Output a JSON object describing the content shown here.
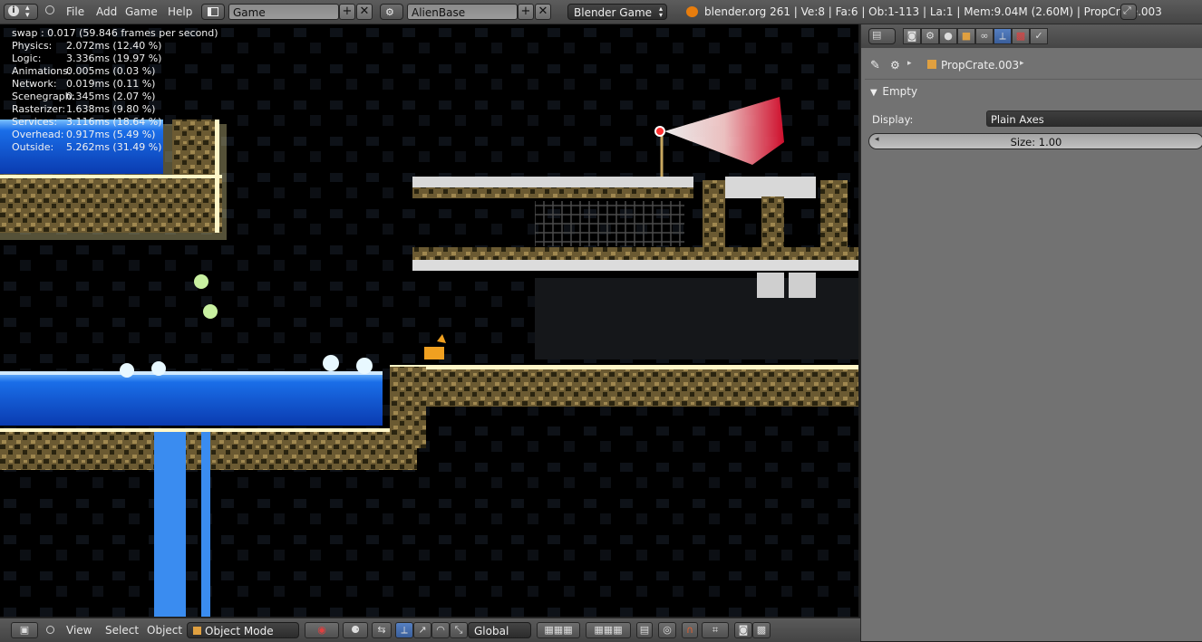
{
  "topbar": {
    "menus": [
      "File",
      "Add",
      "Game",
      "Help"
    ],
    "screen_name": "Game",
    "scene_name": "AlienBase",
    "engine": "Blender Game",
    "stats": "blender.org 261 | Ve:8 | Fa:6 | Ob:1-113 | La:1 | Mem:9.04M (2.60M) | PropCrate.003"
  },
  "profiler": {
    "swap": "swap : 0.017 (59.846 frames per second)",
    "rows": [
      {
        "label": "Physics:",
        "value": "2.072ms (12.40 %)",
        "fraction": 0.124
      },
      {
        "label": "Logic:",
        "value": "3.336ms (19.97 %)",
        "fraction": 0.1997
      },
      {
        "label": "Animations:",
        "value": "0.005ms (0.03 %)",
        "fraction": 0.0003
      },
      {
        "label": "Network:",
        "value": "0.019ms (0.11 %)",
        "fraction": 0.0011
      },
      {
        "label": "Scenegraph:",
        "value": "0.345ms (2.07 %)",
        "fraction": 0.0207
      },
      {
        "label": "Rasterizer:",
        "value": "1.638ms (9.80 %)",
        "fraction": 0.098
      },
      {
        "label": "Services:",
        "value": "3.116ms (18.64 %)",
        "fraction": 0.1864
      },
      {
        "label": "Overhead:",
        "value": "0.917ms (5.49 %)",
        "fraction": 0.0549
      },
      {
        "label": "Outside:",
        "value": "5.262ms (31.49 %)",
        "fraction": 0.3149
      }
    ]
  },
  "bottombar": {
    "menus": [
      "View",
      "Select",
      "Object"
    ],
    "mode": "Object Mode",
    "orientation": "Global"
  },
  "properties": {
    "object_name": "PropCrate.003",
    "panel_title": "Empty",
    "display_label": "Display:",
    "display_value": "Plain Axes",
    "size_field": "Size: 1.00"
  },
  "colors": {
    "accent_blue": "#5680c2",
    "lava_red": "#e01010",
    "water_blue": "#1a6ee8",
    "ground_gold": "#c8a860"
  }
}
